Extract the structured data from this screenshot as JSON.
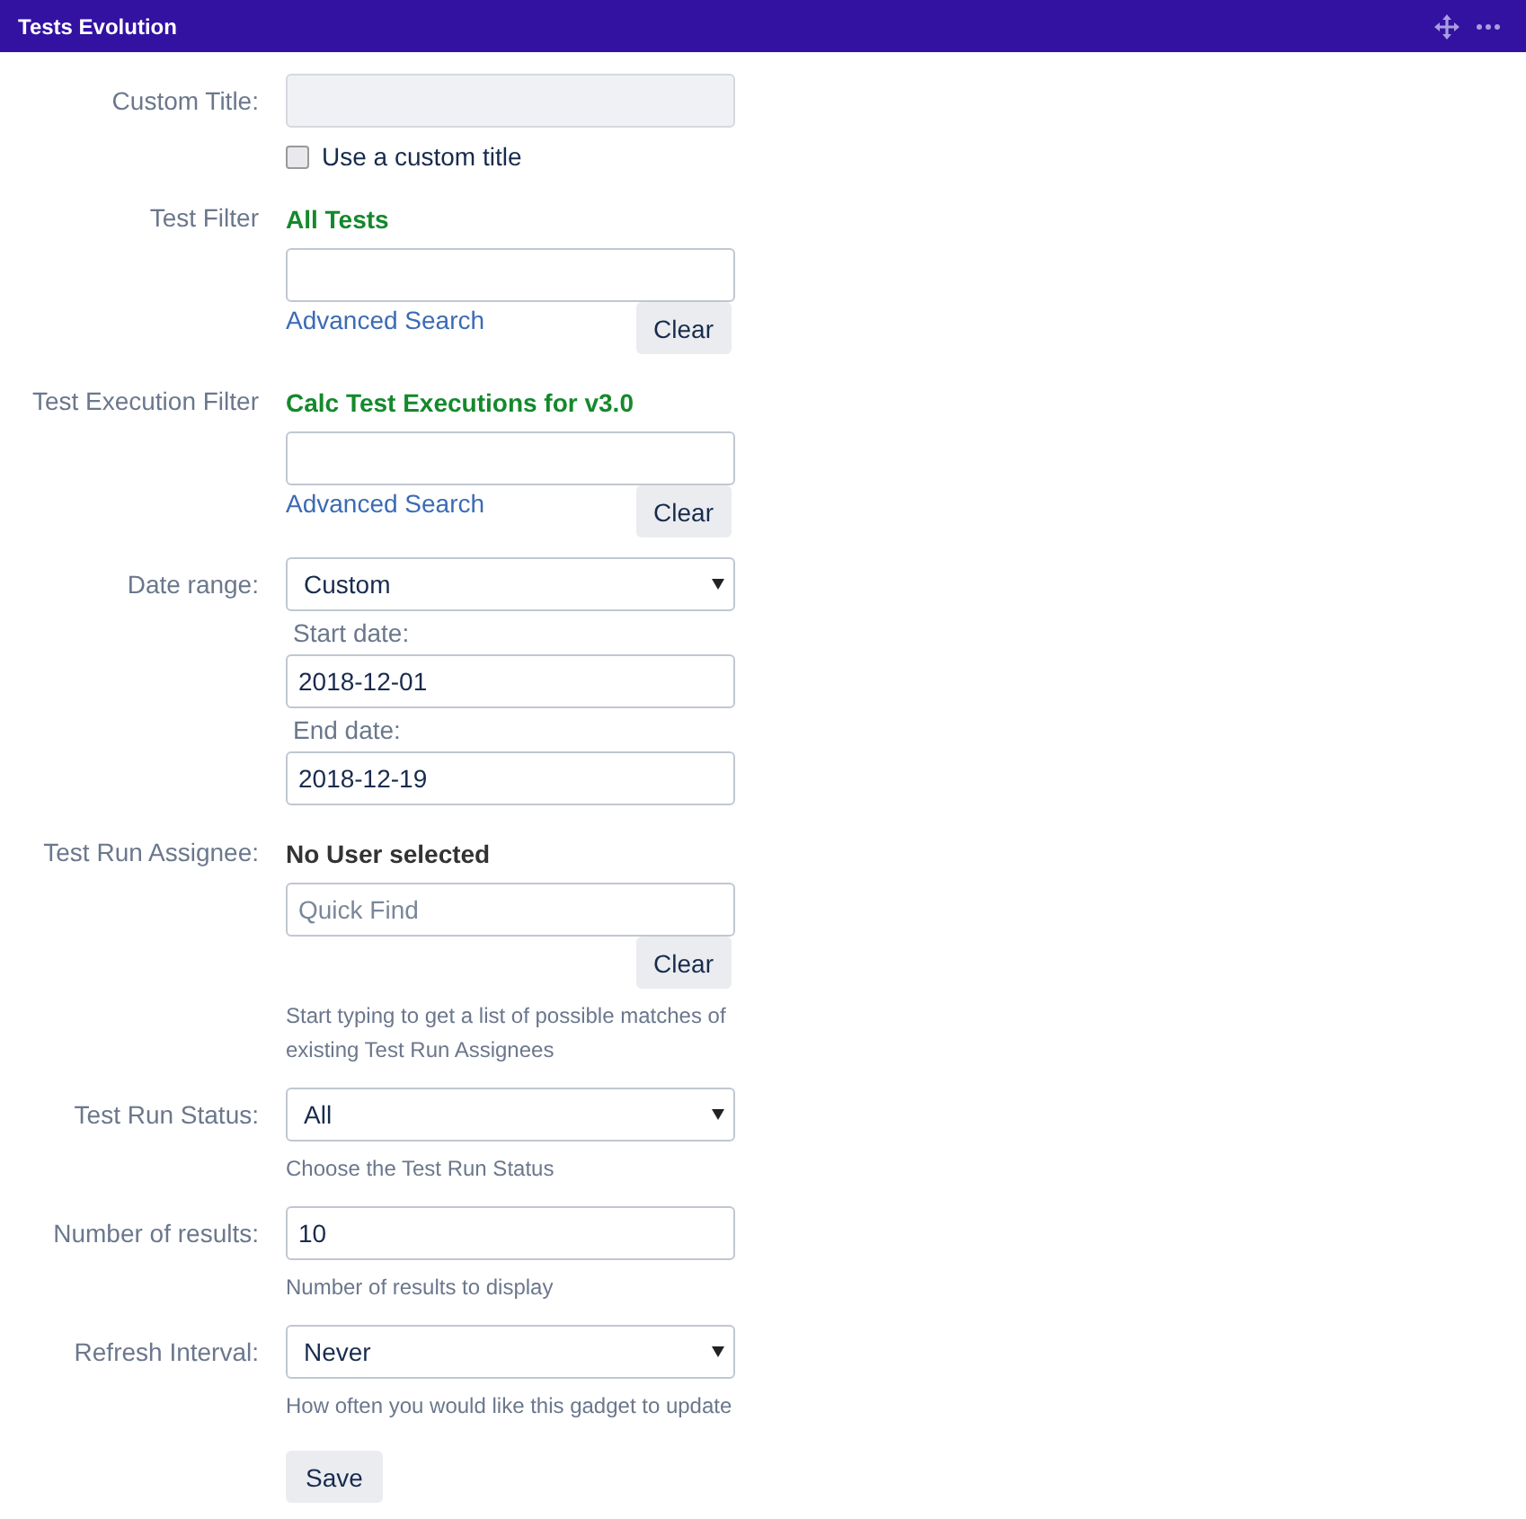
{
  "header": {
    "title": "Tests Evolution"
  },
  "fields": [
    {
      "kind": "custom_title",
      "label": "Custom Title:",
      "disabled": true,
      "checkbox": {
        "label": "Use a custom title",
        "checked": false
      }
    },
    {
      "kind": "filter",
      "label": "Test Filter",
      "selection": "All Tests",
      "link": "Advanced Search",
      "button": "Clear"
    },
    {
      "kind": "filter",
      "label": "Test Execution Filter",
      "selection": "Calc Test Executions for v3.0",
      "link": "Advanced Search",
      "button": "Clear"
    },
    {
      "kind": "select",
      "label": "Date range:",
      "value": "Custom",
      "subfields": [
        {
          "label": "Start date:",
          "value": "2018-12-01"
        },
        {
          "label": "End date:",
          "value": "2018-12-19"
        }
      ]
    },
    {
      "kind": "user",
      "label": "Test Run Assignee:",
      "selection": "No User selected",
      "placeholder": "Quick Find",
      "button": "Clear",
      "hint": "Start typing to get a list of possible matches of existing Test Run Assignees"
    },
    {
      "kind": "select",
      "label": "Test Run Status:",
      "value": "All",
      "hint": "Choose the Test Run Status"
    },
    {
      "kind": "text",
      "label": "Number of results:",
      "value": "10",
      "hint": "Number of results to display"
    },
    {
      "kind": "select",
      "label": "Refresh Interval:",
      "value": "Never",
      "hint": "How often you would like this gadget to update"
    }
  ],
  "save_button": "Save"
}
